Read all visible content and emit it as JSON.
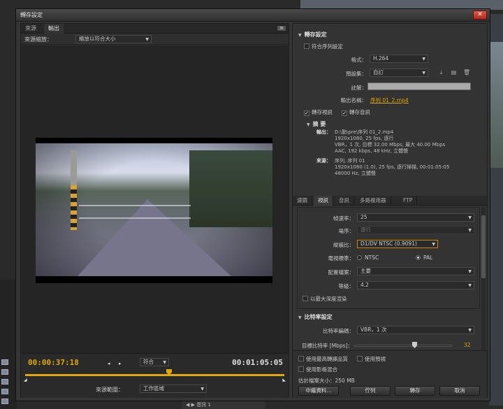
{
  "dialog": {
    "title": "轉存設定",
    "close": "✕"
  },
  "left": {
    "tabs": [
      "來源",
      "輸出"
    ],
    "scale_label": "來源縮放：",
    "scale_value": "縮放以符合大小",
    "timecode_in": "00:00:37:18",
    "timecode_out": "00:01:05:05",
    "fit_value": "符合",
    "range_label": "來源範圍：",
    "range_value": "工作區域"
  },
  "export": {
    "header": "轉存設定",
    "match_sequence": "符合序列設定",
    "format_label": "格式：",
    "format_value": "H.264",
    "preset_label": "預設集：",
    "preset_value": "自訂",
    "comment_label": "註解：",
    "output_label": "輸出名稱：",
    "output_value": "序列 01_2.mp4",
    "export_video": "轉存視訊",
    "export_audio": "轉存音訊"
  },
  "summary": {
    "header": "摘 要",
    "output_label": "輸出：",
    "output_text": "D:\\勤\\pre\\序列 01_2.mp4\n1920x1080, 25 fps, 逐行\nVBR，1 次, 目標 32.00 Mbps, 最大 40.00 Mbps\nAAC, 192 kbps, 48 kHz, 立體聲",
    "source_label": "來源：",
    "source_text": "序列, 序列 01\n1920x1080 (1.0), 25 fps, 逐行掃描, 00:01:05:05\n48000 Hz, 立體聲"
  },
  "tabs2": [
    "濾鏡",
    "視訊",
    "音訊",
    "多路複用器",
    "FTP"
  ],
  "video": {
    "framerate_label": "幀速率：",
    "framerate_value": "25",
    "field_label": "場序：",
    "field_value": "逐行",
    "aspect_label": "縱橫比：",
    "aspect_value": "D1/DV NTSC (0.9091)",
    "tv_label": "電視標準：",
    "ntsc": "NTSC",
    "pal": "PAL",
    "profile_label": "配置檔案：",
    "profile_value": "主要",
    "level_label": "等級：",
    "level_value": "4.2",
    "max_depth": "以最大深度渲染"
  },
  "bitrate": {
    "header": "比特率設定",
    "encoding_label": "比特率編碼：",
    "encoding_value": "VBR，1 次",
    "target_label": "目標比特率 [Mbps]：",
    "target_value": "32"
  },
  "options": {
    "max_quality": "使用最高轉譯品質",
    "use_preview": "使用預視",
    "frame_blend": "使用影格混合",
    "filesize": "估計檔案大小：250 MB"
  },
  "buttons": {
    "metadata": "中繼資料...",
    "queue": "佇列",
    "export": "轉存",
    "cancel": "取消"
  },
  "background": {
    "audio_tab": "音訊 1"
  }
}
